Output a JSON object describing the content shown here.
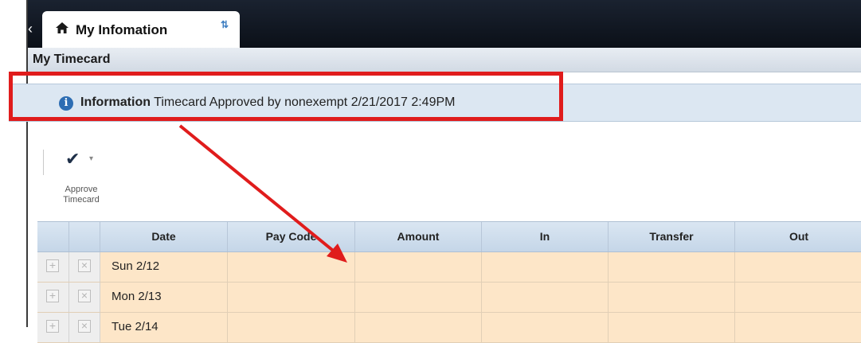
{
  "tabs": {
    "active_tab_label": "My Infomation",
    "home_icon": "home-icon",
    "refresh_icon": "refresh-icon",
    "refresh_glyph": "⇅"
  },
  "panel": {
    "title": "My Timecard"
  },
  "info_bar": {
    "icon": "info-icon",
    "icon_glyph": "i",
    "prefix": "Information",
    "message": "Timecard Approved by nonexempt 2/21/2017 2:49PM"
  },
  "toolbar": {
    "approve_icon": "check-icon",
    "approve_glyph": "✔",
    "caret_glyph": "▾",
    "approve_label_line1": "Approve",
    "approve_label_line2": "Timecard"
  },
  "grid": {
    "columns": [
      "Date",
      "Pay Code",
      "Amount",
      "In",
      "Transfer",
      "Out"
    ],
    "add_glyph": "+",
    "delete_glyph": "×",
    "rows": [
      {
        "date": "Sun 2/12"
      },
      {
        "date": "Mon 2/13"
      },
      {
        "date": "Tue 2/14"
      }
    ]
  },
  "colors": {
    "annotation_red": "#e01c1c",
    "row_highlight": "#fde6c8",
    "info_bar_bg": "#dce7f2",
    "tabbar_bg": "#0b1018"
  }
}
